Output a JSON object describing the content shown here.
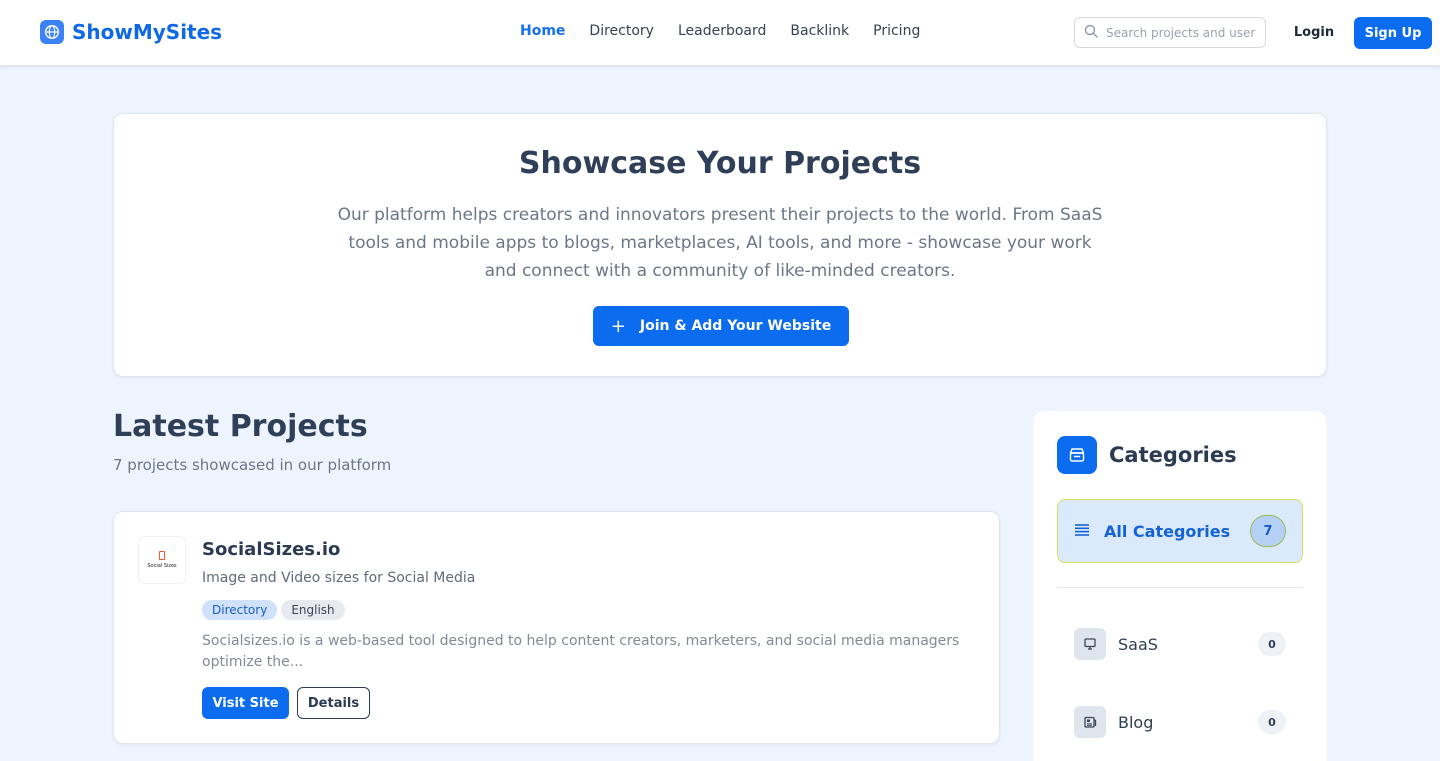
{
  "header": {
    "brand": "ShowMySites",
    "nav": [
      {
        "label": "Home",
        "active": true
      },
      {
        "label": "Directory"
      },
      {
        "label": "Leaderboard"
      },
      {
        "label": "Backlink"
      },
      {
        "label": "Pricing"
      }
    ],
    "search_placeholder": "Search projects and users...",
    "login_label": "Login",
    "signup_label": "Sign Up"
  },
  "hero": {
    "title": "Showcase Your Projects",
    "description": "Our platform helps creators and innovators present their projects to the world. From SaaS tools and mobile apps to blogs, marketplaces, AI tools, and more - showcase your work and connect with a community of like-minded creators.",
    "cta_icon": "+",
    "cta_label": "Join & Add Your Website"
  },
  "latest": {
    "title": "Latest Projects",
    "subtitle": "7 projects showcased in our platform",
    "projects": [
      {
        "name": "SocialSizes.io",
        "thumb_text": "Social Sizes",
        "tagline": "Image and Video sizes for Social Media",
        "tags": [
          "Directory",
          "English"
        ],
        "description": "Socialsizes.io is a web-based tool designed to help content creators, marketers, and social media managers optimize the...",
        "visit_label": "Visit Site",
        "details_label": "Details"
      }
    ]
  },
  "categories": {
    "title": "Categories",
    "all": {
      "label": "All Categories",
      "count": "7"
    },
    "items": [
      {
        "label": "SaaS",
        "count": "0",
        "icon": "monitor-icon"
      },
      {
        "label": "Blog",
        "count": "0",
        "icon": "newspaper-icon"
      }
    ]
  },
  "colors": {
    "accent": "#0b6cf0",
    "background": "#eef4fd",
    "heading": "#2e3f57"
  }
}
